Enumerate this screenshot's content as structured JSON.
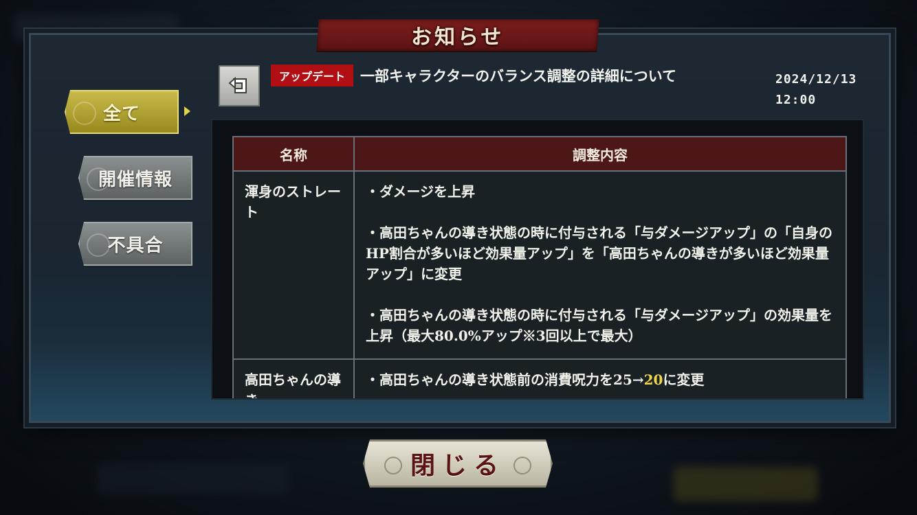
{
  "header": {
    "title": "お知らせ"
  },
  "sidebar": {
    "tabs": [
      {
        "label": "全て",
        "active": true
      },
      {
        "label": "開催情報",
        "active": false
      },
      {
        "label": "不具合",
        "active": false
      }
    ]
  },
  "article": {
    "category": "アップデート",
    "title": "一部キャラクターのバランス調整の詳細について",
    "date": "2024/12/13",
    "time": "12:00"
  },
  "table": {
    "headers": [
      "名称",
      "調整内容"
    ],
    "rows": [
      {
        "name": "渾身のストレート",
        "details": [
          "・ダメージを上昇",
          "・高田ちゃんの導き状態の時に付与される「与ダメージアップ」の「自身のHP割合が多いほど効果量アップ」を「高田ちゃんの導きが多いほど効果量アップ」に変更",
          "・高田ちゃんの導き状態の時に付与される「与ダメージアップ」の効果量を上昇（最大80.0%アップ※3回以上で最大）"
        ]
      },
      {
        "name": "高田ちゃんの導き",
        "details_prefix": "・高田ちゃんの導き状態前の消費呪力を25→",
        "details_highlight": "20",
        "details_suffix": "に変更"
      }
    ]
  },
  "footer": {
    "close_label": "閉じる"
  },
  "colors": {
    "accent_red": "#b20f14",
    "active_tab": "#c9bb4a",
    "highlight": "#f0d64a",
    "table_header": "#4d1717"
  }
}
